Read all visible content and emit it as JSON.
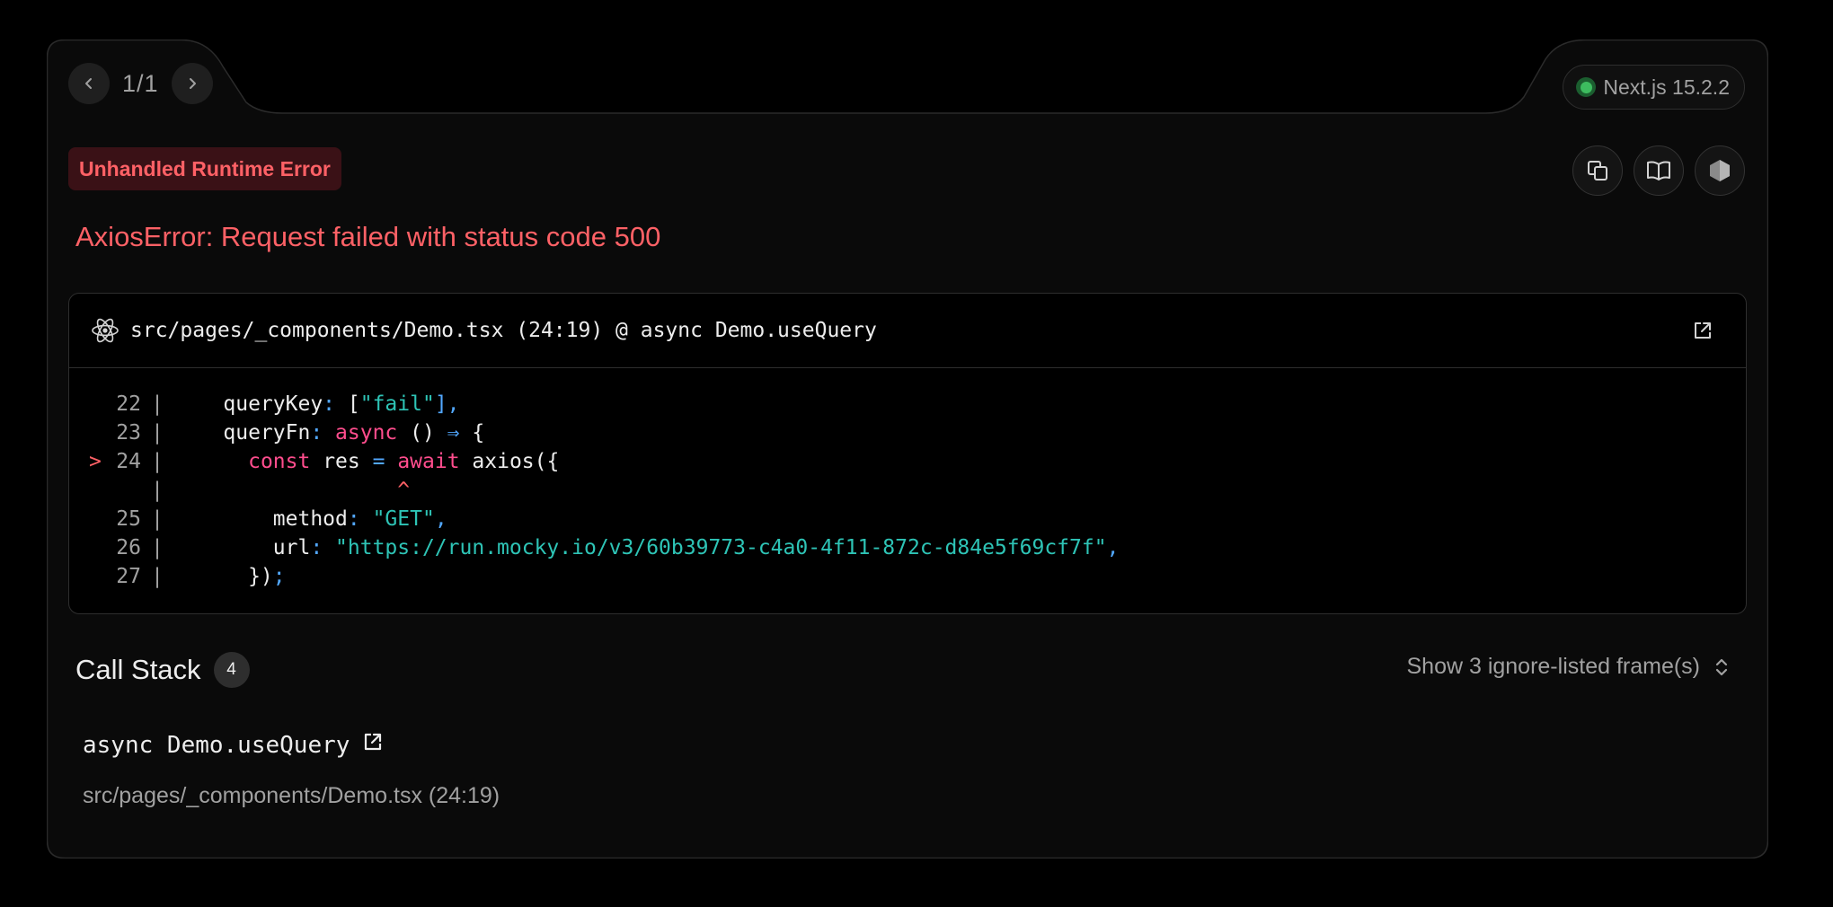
{
  "pagination": {
    "count": "1/1"
  },
  "version": {
    "label": "Next.js 15.2.2",
    "status_color": "#3dbc5f"
  },
  "error": {
    "label": "Unhandled Runtime Error",
    "message": "AxiosError: Request failed with status code 500"
  },
  "code_frame": {
    "file_location": "src/pages/_components/Demo.tsx (24:19) @ async Demo.useQuery",
    "lines": [
      {
        "marker": "",
        "number": "22",
        "sep": "|",
        "tokens": [
          {
            "t": "    queryKey",
            "c": "plain"
          },
          {
            "t": ": ",
            "c": "punc"
          },
          {
            "t": "[",
            "c": "plain"
          },
          {
            "t": "\"fail\"",
            "c": "str"
          },
          {
            "t": "],",
            "c": "punc"
          }
        ]
      },
      {
        "marker": "",
        "number": "23",
        "sep": "|",
        "tokens": [
          {
            "t": "    queryFn",
            "c": "plain"
          },
          {
            "t": ": ",
            "c": "punc"
          },
          {
            "t": "async",
            "c": "kw"
          },
          {
            "t": " () ",
            "c": "plain"
          },
          {
            "t": "⇒",
            "c": "punc"
          },
          {
            "t": " {",
            "c": "plain"
          }
        ]
      },
      {
        "marker": ">",
        "number": "24",
        "sep": "|",
        "tokens": [
          {
            "t": "      ",
            "c": "plain"
          },
          {
            "t": "const",
            "c": "kw"
          },
          {
            "t": " res ",
            "c": "plain"
          },
          {
            "t": "=",
            "c": "punc"
          },
          {
            "t": " ",
            "c": "plain"
          },
          {
            "t": "await",
            "c": "kw"
          },
          {
            "t": " axios({",
            "c": "plain"
          }
        ]
      },
      {
        "marker": "",
        "number": "",
        "sep": "|",
        "tokens": [
          {
            "t": "                  ",
            "c": "plain"
          },
          {
            "t": "^",
            "c": "caret"
          }
        ]
      },
      {
        "marker": "",
        "number": "25",
        "sep": "|",
        "tokens": [
          {
            "t": "        method",
            "c": "plain"
          },
          {
            "t": ": ",
            "c": "punc"
          },
          {
            "t": "\"GET\"",
            "c": "str"
          },
          {
            "t": ",",
            "c": "punc"
          }
        ]
      },
      {
        "marker": "",
        "number": "26",
        "sep": "|",
        "tokens": [
          {
            "t": "        url",
            "c": "plain"
          },
          {
            "t": ": ",
            "c": "punc"
          },
          {
            "t": "\"https://run.mocky.io/v3/60b39773-c4a0-4f11-872c-d84e5f69cf7f\"",
            "c": "str"
          },
          {
            "t": ",",
            "c": "punc"
          }
        ]
      },
      {
        "marker": "",
        "number": "27",
        "sep": "|",
        "tokens": [
          {
            "t": "      })",
            "c": "plain"
          },
          {
            "t": ";",
            "c": "punc"
          }
        ]
      }
    ]
  },
  "call_stack": {
    "title": "Call Stack",
    "count": "4",
    "ignore_toggle": "Show 3 ignore-listed frame(s)",
    "frames": [
      {
        "method": "async Demo.useQuery",
        "location": "src/pages/_components/Demo.tsx (24:19)"
      }
    ]
  },
  "icons": {
    "prev": "chevron-left-icon",
    "next": "chevron-right-icon",
    "copy": "copy-icon",
    "docs": "book-open-icon",
    "node": "nodejs-icon",
    "react": "react-icon",
    "external": "external-link-icon",
    "toggle": "chevron-up-down-icon"
  }
}
